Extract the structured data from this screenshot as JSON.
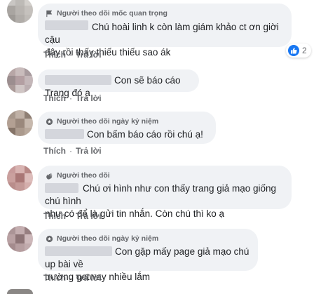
{
  "actions": {
    "like": "Thích",
    "reply": "Trả lời",
    "separator": "·"
  },
  "comments": [
    {
      "badge": "Người theo dõi mốc quan trọng",
      "badge_icon": "flag-icon",
      "lines": [
        "Chú hoài linh k còn làm giám khảo ct ơn giời cậu",
        "đây rồi thấy thiếu thiếu sao ák"
      ],
      "reaction": {
        "icon": "like-icon",
        "count": "2"
      }
    },
    {
      "badge": "",
      "lines": [
        "Con sẽ báo cáo Trang đó ạ"
      ]
    },
    {
      "badge": "Người theo dõi ngày kỷ niệm",
      "badge_icon": "anniversary-icon",
      "lines": [
        "Con bấm báo cáo rồi chú ạ!"
      ]
    },
    {
      "badge": "Người theo dõi",
      "badge_icon": "wave-hand-icon",
      "lines": [
        "Chú ơi hình như con thấy trang giả mạo giống chú hình",
        "như có để là gửi tin nhắn. Còn chú thì ko ạ"
      ]
    },
    {
      "badge": "Người theo dõi ngày kỷ niệm",
      "badge_icon": "anniversary-icon",
      "lines": [
        "Con gặp mấy page giả mạo chú up bài về",
        "trường getway nhiều lắm"
      ]
    }
  ],
  "colors": {
    "bubble": "#f0f2f5",
    "link_blue": "#1877f2",
    "meta_gray": "#65676b"
  }
}
